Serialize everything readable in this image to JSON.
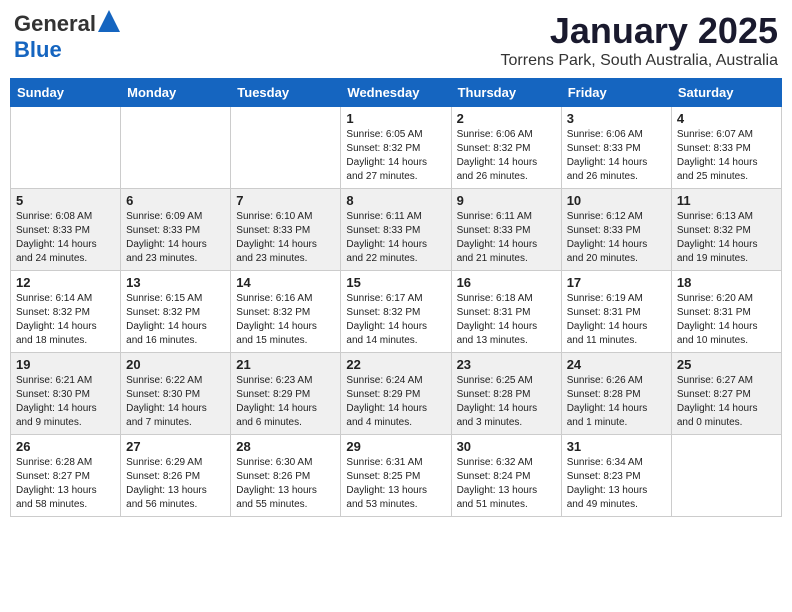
{
  "header": {
    "logo_general": "General",
    "logo_blue": "Blue",
    "month_title": "January 2025",
    "location": "Torrens Park, South Australia, Australia"
  },
  "days_of_week": [
    "Sunday",
    "Monday",
    "Tuesday",
    "Wednesday",
    "Thursday",
    "Friday",
    "Saturday"
  ],
  "weeks": [
    [
      {
        "day": "",
        "info": ""
      },
      {
        "day": "",
        "info": ""
      },
      {
        "day": "",
        "info": ""
      },
      {
        "day": "1",
        "info": "Sunrise: 6:05 AM\nSunset: 8:32 PM\nDaylight: 14 hours and 27 minutes."
      },
      {
        "day": "2",
        "info": "Sunrise: 6:06 AM\nSunset: 8:32 PM\nDaylight: 14 hours and 26 minutes."
      },
      {
        "day": "3",
        "info": "Sunrise: 6:06 AM\nSunset: 8:33 PM\nDaylight: 14 hours and 26 minutes."
      },
      {
        "day": "4",
        "info": "Sunrise: 6:07 AM\nSunset: 8:33 PM\nDaylight: 14 hours and 25 minutes."
      }
    ],
    [
      {
        "day": "5",
        "info": "Sunrise: 6:08 AM\nSunset: 8:33 PM\nDaylight: 14 hours and 24 minutes."
      },
      {
        "day": "6",
        "info": "Sunrise: 6:09 AM\nSunset: 8:33 PM\nDaylight: 14 hours and 23 minutes."
      },
      {
        "day": "7",
        "info": "Sunrise: 6:10 AM\nSunset: 8:33 PM\nDaylight: 14 hours and 23 minutes."
      },
      {
        "day": "8",
        "info": "Sunrise: 6:11 AM\nSunset: 8:33 PM\nDaylight: 14 hours and 22 minutes."
      },
      {
        "day": "9",
        "info": "Sunrise: 6:11 AM\nSunset: 8:33 PM\nDaylight: 14 hours and 21 minutes."
      },
      {
        "day": "10",
        "info": "Sunrise: 6:12 AM\nSunset: 8:33 PM\nDaylight: 14 hours and 20 minutes."
      },
      {
        "day": "11",
        "info": "Sunrise: 6:13 AM\nSunset: 8:32 PM\nDaylight: 14 hours and 19 minutes."
      }
    ],
    [
      {
        "day": "12",
        "info": "Sunrise: 6:14 AM\nSunset: 8:32 PM\nDaylight: 14 hours and 18 minutes."
      },
      {
        "day": "13",
        "info": "Sunrise: 6:15 AM\nSunset: 8:32 PM\nDaylight: 14 hours and 16 minutes."
      },
      {
        "day": "14",
        "info": "Sunrise: 6:16 AM\nSunset: 8:32 PM\nDaylight: 14 hours and 15 minutes."
      },
      {
        "day": "15",
        "info": "Sunrise: 6:17 AM\nSunset: 8:32 PM\nDaylight: 14 hours and 14 minutes."
      },
      {
        "day": "16",
        "info": "Sunrise: 6:18 AM\nSunset: 8:31 PM\nDaylight: 14 hours and 13 minutes."
      },
      {
        "day": "17",
        "info": "Sunrise: 6:19 AM\nSunset: 8:31 PM\nDaylight: 14 hours and 11 minutes."
      },
      {
        "day": "18",
        "info": "Sunrise: 6:20 AM\nSunset: 8:31 PM\nDaylight: 14 hours and 10 minutes."
      }
    ],
    [
      {
        "day": "19",
        "info": "Sunrise: 6:21 AM\nSunset: 8:30 PM\nDaylight: 14 hours and 9 minutes."
      },
      {
        "day": "20",
        "info": "Sunrise: 6:22 AM\nSunset: 8:30 PM\nDaylight: 14 hours and 7 minutes."
      },
      {
        "day": "21",
        "info": "Sunrise: 6:23 AM\nSunset: 8:29 PM\nDaylight: 14 hours and 6 minutes."
      },
      {
        "day": "22",
        "info": "Sunrise: 6:24 AM\nSunset: 8:29 PM\nDaylight: 14 hours and 4 minutes."
      },
      {
        "day": "23",
        "info": "Sunrise: 6:25 AM\nSunset: 8:28 PM\nDaylight: 14 hours and 3 minutes."
      },
      {
        "day": "24",
        "info": "Sunrise: 6:26 AM\nSunset: 8:28 PM\nDaylight: 14 hours and 1 minute."
      },
      {
        "day": "25",
        "info": "Sunrise: 6:27 AM\nSunset: 8:27 PM\nDaylight: 14 hours and 0 minutes."
      }
    ],
    [
      {
        "day": "26",
        "info": "Sunrise: 6:28 AM\nSunset: 8:27 PM\nDaylight: 13 hours and 58 minutes."
      },
      {
        "day": "27",
        "info": "Sunrise: 6:29 AM\nSunset: 8:26 PM\nDaylight: 13 hours and 56 minutes."
      },
      {
        "day": "28",
        "info": "Sunrise: 6:30 AM\nSunset: 8:26 PM\nDaylight: 13 hours and 55 minutes."
      },
      {
        "day": "29",
        "info": "Sunrise: 6:31 AM\nSunset: 8:25 PM\nDaylight: 13 hours and 53 minutes."
      },
      {
        "day": "30",
        "info": "Sunrise: 6:32 AM\nSunset: 8:24 PM\nDaylight: 13 hours and 51 minutes."
      },
      {
        "day": "31",
        "info": "Sunrise: 6:34 AM\nSunset: 8:23 PM\nDaylight: 13 hours and 49 minutes."
      },
      {
        "day": "",
        "info": ""
      }
    ]
  ]
}
